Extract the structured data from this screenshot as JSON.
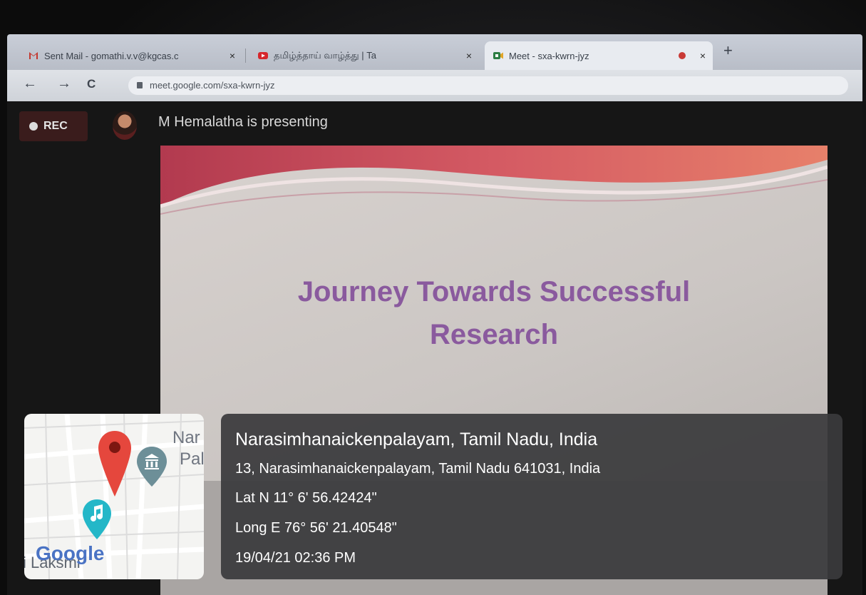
{
  "browser": {
    "tabs": [
      {
        "label": "Sent Mail - gomathi.v.v@kgcas.c",
        "active": false
      },
      {
        "label": "தமிழ்த்தாய் வாழ்த்து | Ta",
        "active": false
      },
      {
        "label": "Meet - sxa-kwrn-jyz",
        "active": true
      }
    ],
    "new_tab_symbol": "+",
    "close_symbol": "×",
    "back_symbol": "←",
    "forward_symbol": "→",
    "reload_symbol": "C",
    "url": "meet.google.com/sxa-kwrn-jyz"
  },
  "meet": {
    "rec_label": "REC",
    "presenting_text": "M Hemalatha is presenting",
    "slide_title_line1": "Journey Towards Successful",
    "slide_title_line2": "Research"
  },
  "geotag": {
    "map_label_1": "Nar",
    "map_label_2": "Pal",
    "map_label_3": "i Laksmi",
    "map_logo": "Google",
    "title": "Narasimhanaickenpalayam, Tamil Nadu, India",
    "address": "13, Narasimhanaickenpalayam, Tamil Nadu 641031, India",
    "latitude": "Lat N 11° 6' 56.42424\"",
    "longitude": "Long E 76° 56' 21.40548\"",
    "datetime": "19/04/21 02:36 PM"
  },
  "colors": {
    "slide_title": "#8a5a9e",
    "map_pin": "#e5473d",
    "info_panel": "#3a3a3c",
    "rec_bg": "#3a1c1c"
  }
}
